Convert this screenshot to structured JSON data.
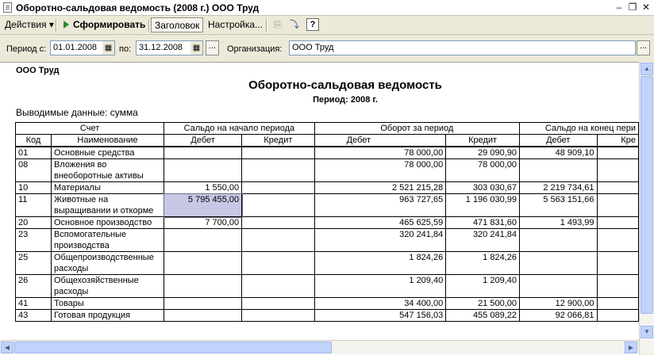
{
  "window": {
    "title": "Оборотно-сальдовая ведомость (2008 г.) ООО Труд",
    "minimize_glyph": "–",
    "restore_glyph": "❐",
    "close_glyph": "✕"
  },
  "toolbar": {
    "actions_label": "Действия",
    "actions_arrow": "▾",
    "generate_label": "Сформировать",
    "header_label": "Заголовок",
    "settings_label": "Настройка...",
    "icons": [
      "copy-icon",
      "expand-icon",
      "help-icon"
    ],
    "help_glyph": "?",
    "copy_glyph": "⎘",
    "expand_glyph": "⤵"
  },
  "filters": {
    "period_from_label": "Период с:",
    "period_from_value": "01.01.2008",
    "period_to_label": "по:",
    "period_to_value": "31.12.2008",
    "period_dots": "...",
    "org_label": "Организация:",
    "org_value": "ООО Труд",
    "org_dots": "...",
    "calendar_glyph": "▦"
  },
  "report": {
    "org_name": "ООО Труд",
    "title": "Оборотно-сальдовая ведомость",
    "period": "Период: 2008 г.",
    "output": "Выводимые данные: сумма",
    "header": {
      "account": "Счет",
      "opening": "Сальдо на начало периода",
      "turnover": "Оборот за период",
      "closing": "Сальдо на конец пери",
      "code": "Код",
      "name": "Наименование",
      "debit": "Дебет",
      "credit": "Кредит",
      "credit_cut": "Кре"
    },
    "rows": [
      {
        "code": "01",
        "name": "Основные средства",
        "od": "",
        "oc": "",
        "td": "78 000,00",
        "tc": "29 090,90",
        "cd": "48 909,10"
      },
      {
        "code": "08",
        "name": "Вложения во внеоборотные активы",
        "od": "",
        "oc": "",
        "td": "78 000,00",
        "tc": "78 000,00",
        "cd": ""
      },
      {
        "code": "10",
        "name": "Материалы",
        "od": "1 550,00",
        "oc": "",
        "td": "2 521 215,28",
        "tc": "303 030,67",
        "cd": "2 219 734,61"
      },
      {
        "code": "11",
        "name": "Животные на выращивании и откорме",
        "od": "5 795 455,00",
        "oc": "",
        "td": "963 727,65",
        "tc": "1 196 030,99",
        "cd": "5 563 151,66"
      },
      {
        "code": "20",
        "name": "Основное производство",
        "od": "7 700,00",
        "oc": "",
        "td": "465 625,59",
        "tc": "471 831,60",
        "cd": "1 493,99"
      },
      {
        "code": "23",
        "name": "Вспомогательные производства",
        "od": "",
        "oc": "",
        "td": "320 241,84",
        "tc": "320 241,84",
        "cd": ""
      },
      {
        "code": "25",
        "name": "Общепроизводственные расходы",
        "od": "",
        "oc": "",
        "td": "1 824,26",
        "tc": "1 824,26",
        "cd": ""
      },
      {
        "code": "26",
        "name": "Общехозяйственные расходы",
        "od": "",
        "oc": "",
        "td": "1 209,40",
        "tc": "1 209,40",
        "cd": ""
      },
      {
        "code": "41",
        "name": "Товары",
        "od": "",
        "oc": "",
        "td": "34 400,00",
        "tc": "21 500,00",
        "cd": "12 900,00"
      },
      {
        "code": "43",
        "name": "Готовая продукция",
        "od": "",
        "oc": "",
        "td": "547 156,03",
        "tc": "455 089,22",
        "cd": "92 066,81"
      }
    ],
    "selected_cell": {
      "row": 3,
      "col": "od"
    }
  }
}
